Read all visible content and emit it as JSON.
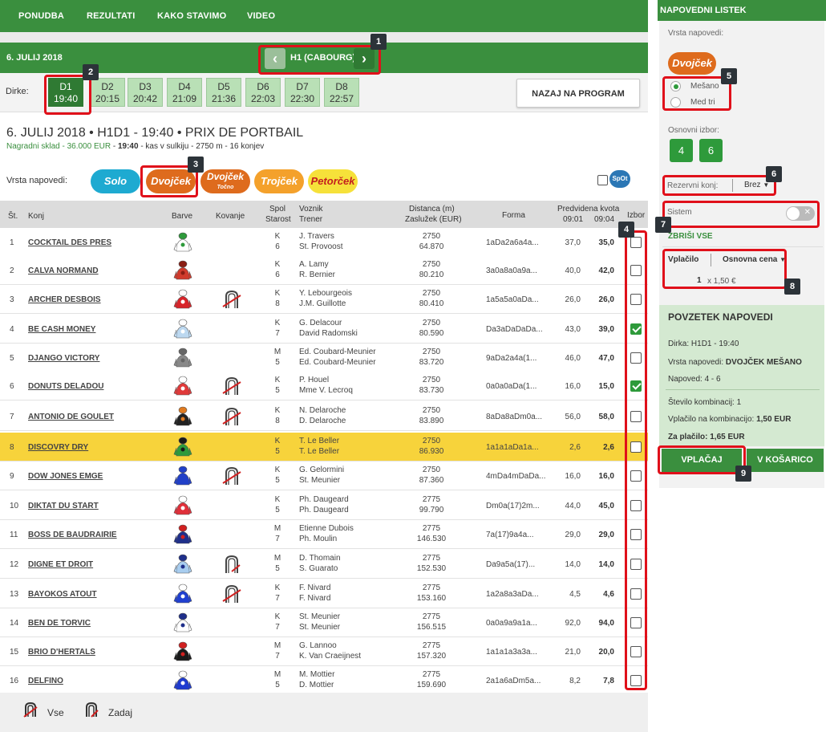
{
  "nav": [
    "PONUDBA",
    "REZULTATI",
    "KAKO STAVIMO",
    "VIDEO"
  ],
  "date": "6. JULIJ 2018",
  "race_name": "H1 (CABOURG)",
  "prev_icon": "chevron-left-icon",
  "next_icon": "chevron-right-icon",
  "dirke_label": "Dirke:",
  "races": [
    {
      "code": "D1",
      "time": "19:40"
    },
    {
      "code": "D2",
      "time": "20:15"
    },
    {
      "code": "D3",
      "time": "20:42"
    },
    {
      "code": "D4",
      "time": "21:09"
    },
    {
      "code": "D5",
      "time": "21:36"
    },
    {
      "code": "D6",
      "time": "22:03"
    },
    {
      "code": "D7",
      "time": "22:30"
    },
    {
      "code": "D8",
      "time": "22:57"
    }
  ],
  "back_label": "NAZAJ NA PROGRAM",
  "title": "6. JULIJ 2018 • H1D1 - 19:40 • PRIX DE PORTBAIL",
  "subtitle": {
    "prize": "Nagradni sklad - 36.000 EUR",
    "time": "19:40",
    "rest": "- kas v sulkiju - 2750 m - 16 konjev"
  },
  "bet_types_label": "Vrsta napovedi:",
  "bet_types": {
    "solo": "Solo",
    "dvojcek": "Dvojček",
    "dvojcek_t": "Dvojček",
    "dvojcek_t_sub": "Točno",
    "trojcek": "Trojček",
    "petorcek": "Petorček"
  },
  "spot_label": "SpOt",
  "colors": {
    "green": "#3a8f3e",
    "highlight": "#f7d33b",
    "orange": "#de6b1d",
    "blue": "#1eaad1",
    "callout": "#e0101a"
  },
  "headers": {
    "st": "Št.",
    "konj": "Konj",
    "barve": "Barve",
    "kovanje": "Kovanje",
    "spol": "Spol",
    "starost": "Starost",
    "voznik": "Voznik",
    "trener": "Trener",
    "distanca": "Distanca (m)",
    "zasluzek": "Zaslužek (EUR)",
    "forma": "Forma",
    "kvota": "Predvidena kvota",
    "t1": "09:01",
    "t2": "09:04",
    "izbor": "Izbor"
  },
  "horses": [
    {
      "n": "1",
      "name": "COCKTAIL DES PRES",
      "sex": "K",
      "age": "6",
      "driver": "J. Travers",
      "trainer": "St. Provoost",
      "dist": "2750",
      "earn": "64.870",
      "form": "1aDa2a6a4a...",
      "q1": "37,0",
      "q2": "35,0",
      "shoe": "",
      "checked": false,
      "color": "#ffffff",
      "accent": "#2e9a3b"
    },
    {
      "n": "2",
      "name": "CALVA NORMAND",
      "sex": "K",
      "age": "6",
      "driver": "A. Lamy",
      "trainer": "R. Bernier",
      "dist": "2750",
      "earn": "80.210",
      "form": "3a0a8a0a9a...",
      "q1": "40,0",
      "q2": "42,0",
      "shoe": "",
      "checked": false,
      "color": "#d03a2c",
      "accent": "#8a1e14"
    },
    {
      "n": "3",
      "name": "ARCHER DESBOIS",
      "sex": "K",
      "age": "8",
      "driver": "Y. Lebourgeois",
      "trainer": "J.M. Guillotte",
      "dist": "2750",
      "earn": "80.410",
      "form": "1a5a5a0aDa...",
      "q1": "26,0",
      "q2": "26,0",
      "shoe": "full",
      "checked": false,
      "color": "#d8242a",
      "accent": "#ffffff"
    },
    {
      "n": "4",
      "name": "BE CASH MONEY",
      "sex": "K",
      "age": "7",
      "driver": "G. Delacour",
      "trainer": "David Radomski",
      "dist": "2750",
      "earn": "80.590",
      "form": "Da3aDaDaDa...",
      "q1": "43,0",
      "q2": "39,0",
      "shoe": "",
      "checked": true,
      "color": "#bcd8f0",
      "accent": "#ffffff"
    },
    {
      "n": "5",
      "name": "DJANGO VICTORY",
      "sex": "M",
      "age": "5",
      "driver": "Ed. Coubard-Meunier",
      "trainer": "Ed. Coubard-Meunier",
      "dist": "2750",
      "earn": "83.720",
      "form": "9aDa2a4a(1...",
      "q1": "46,0",
      "q2": "47,0",
      "shoe": "",
      "checked": false,
      "color": "#888888",
      "accent": "#666666"
    },
    {
      "n": "6",
      "name": "DONUTS DELADOU",
      "sex": "K",
      "age": "5",
      "driver": "P. Houel",
      "trainer": "Mme V. Lecroq",
      "dist": "2750",
      "earn": "83.730",
      "form": "0a0a0aDa(1...",
      "q1": "16,0",
      "q2": "15,0",
      "shoe": "full",
      "checked": true,
      "color": "#e03a3a",
      "accent": "#ffffff"
    },
    {
      "n": "7",
      "name": "ANTONIO DE GOULET",
      "sex": "K",
      "age": "8",
      "driver": "N. Delaroche",
      "trainer": "D. Delaroche",
      "dist": "2750",
      "earn": "83.890",
      "form": "8aDa8aDm0a...",
      "q1": "56,0",
      "q2": "58,0",
      "shoe": "full",
      "checked": false,
      "color": "#222222",
      "accent": "#e07a1f"
    },
    {
      "n": "8",
      "name": "DISCOVRY DRY",
      "sex": "K",
      "age": "5",
      "driver": "T. Le Beller",
      "trainer": "T. Le Beller",
      "dist": "2750",
      "earn": "86.930",
      "form": "1a1a1aDa1a...",
      "q1": "2,6",
      "q2": "2,6",
      "shoe": "",
      "checked": false,
      "color": "#2e9a3b",
      "accent": "#1a1a1a"
    },
    {
      "n": "9",
      "name": "DOW JONES EMGE",
      "sex": "K",
      "age": "5",
      "driver": "G. Gelormini",
      "trainer": "St. Meunier",
      "dist": "2750",
      "earn": "87.360",
      "form": "4mDa4mDaDa...",
      "q1": "16,0",
      "q2": "16,0",
      "shoe": "full",
      "checked": false,
      "color": "#2140c8",
      "accent": "#2140c8"
    },
    {
      "n": "10",
      "name": "DIKTAT DU START",
      "sex": "K",
      "age": "5",
      "driver": "Ph. Daugeard",
      "trainer": "Ph. Daugeard",
      "dist": "2775",
      "earn": "99.790",
      "form": "Dm0a(17)2m...",
      "q1": "44,0",
      "q2": "45,0",
      "shoe": "",
      "checked": false,
      "color": "#e0303a",
      "accent": "#ffffff"
    },
    {
      "n": "11",
      "name": "BOSS DE BAUDRAIRIE",
      "sex": "M",
      "age": "7",
      "driver": "Etienne Dubois",
      "trainer": "Ph. Moulin",
      "dist": "2775",
      "earn": "146.530",
      "form": "7a(17)9a4a...",
      "q1": "29,0",
      "q2": "29,0",
      "shoe": "",
      "checked": false,
      "color": "#1f2f8a",
      "accent": "#d02020"
    },
    {
      "n": "12",
      "name": "DIGNE ET DROIT",
      "sex": "M",
      "age": "5",
      "driver": "D. Thomain",
      "trainer": "S. Guarato",
      "dist": "2775",
      "earn": "152.530",
      "form": "Da9a5a(17)...",
      "q1": "14,0",
      "q2": "14,0",
      "shoe": "rear",
      "checked": false,
      "color": "#a8cdef",
      "accent": "#1f2f8a"
    },
    {
      "n": "13",
      "name": "BAYOKOS ATOUT",
      "sex": "K",
      "age": "7",
      "driver": "F. Nivard",
      "trainer": "F. Nivard",
      "dist": "2775",
      "earn": "153.160",
      "form": "1a2a8a3aDa...",
      "q1": "4,5",
      "q2": "4,6",
      "shoe": "full",
      "checked": false,
      "color": "#2040d0",
      "accent": "#ffffff"
    },
    {
      "n": "14",
      "name": "BEN DE TORVIC",
      "sex": "K",
      "age": "7",
      "driver": "St. Meunier",
      "trainer": "St. Meunier",
      "dist": "2775",
      "earn": "156.515",
      "form": "0a0a9a9a1a...",
      "q1": "92,0",
      "q2": "94,0",
      "shoe": "",
      "checked": false,
      "color": "#ffffff",
      "accent": "#1f2f8a"
    },
    {
      "n": "15",
      "name": "BRIO D'HERTALS",
      "sex": "M",
      "age": "7",
      "driver": "G. Lannoo",
      "trainer": "K. Van Craeijnest",
      "dist": "2775",
      "earn": "157.320",
      "form": "1a1a1a3a3a...",
      "q1": "21,0",
      "q2": "20,0",
      "shoe": "",
      "checked": false,
      "color": "#1a1a1a",
      "accent": "#d02020"
    },
    {
      "n": "16",
      "name": "DELFINO",
      "sex": "M",
      "age": "5",
      "driver": "M. Mottier",
      "trainer": "D. Mottier",
      "dist": "2775",
      "earn": "159.690",
      "form": "2a1a6aDm5a...",
      "q1": "8,2",
      "q2": "7,8",
      "shoe": "",
      "checked": false,
      "color": "#1f3bd0",
      "accent": "#ffffff"
    }
  ],
  "legend": {
    "all": "Vse",
    "rear": "Zadaj"
  },
  "side": {
    "header": "NAPOVEDNI LISTEK",
    "type_label": "Vrsta napovedi:",
    "type_value": "Dvojček",
    "radio1": "Mešano",
    "radio2": "Med tri",
    "base_label": "Osnovni izbor:",
    "picks": [
      "4",
      "6"
    ],
    "reserve_label": "Rezervni konj:",
    "reserve_value": "Brez",
    "system_label": "Sistem",
    "clear_all": "ZBRIŠI VSE",
    "stake_label": "Vplačilo",
    "stake_type": "Osnovna cena",
    "stake_mult": "1",
    "stake_amount": "x 1,50 €",
    "summary_header": "POVZETEK NAPOVEDI",
    "race_label": "Dirka:",
    "race_value": "H1D1 - 19:40",
    "type2_label": "Vrsta napovedi:",
    "type2_value": "DVOJČEK MEŠANO",
    "pred_label": "Napoved:",
    "pred_value": "4 - 6",
    "combos_label": "Število kombinacij:",
    "combos_value": "1",
    "percomb_label": "Vplačilo na kombinacijo:",
    "percomb_value": "1,50 EUR",
    "total_label": "Za plačilo:",
    "total_value": "1,65 EUR",
    "pay_button": "VPLAČAJ",
    "cart_button": "V KOŠARICO"
  },
  "badges": [
    "1",
    "2",
    "3",
    "4",
    "5",
    "6",
    "7",
    "8",
    "9"
  ]
}
